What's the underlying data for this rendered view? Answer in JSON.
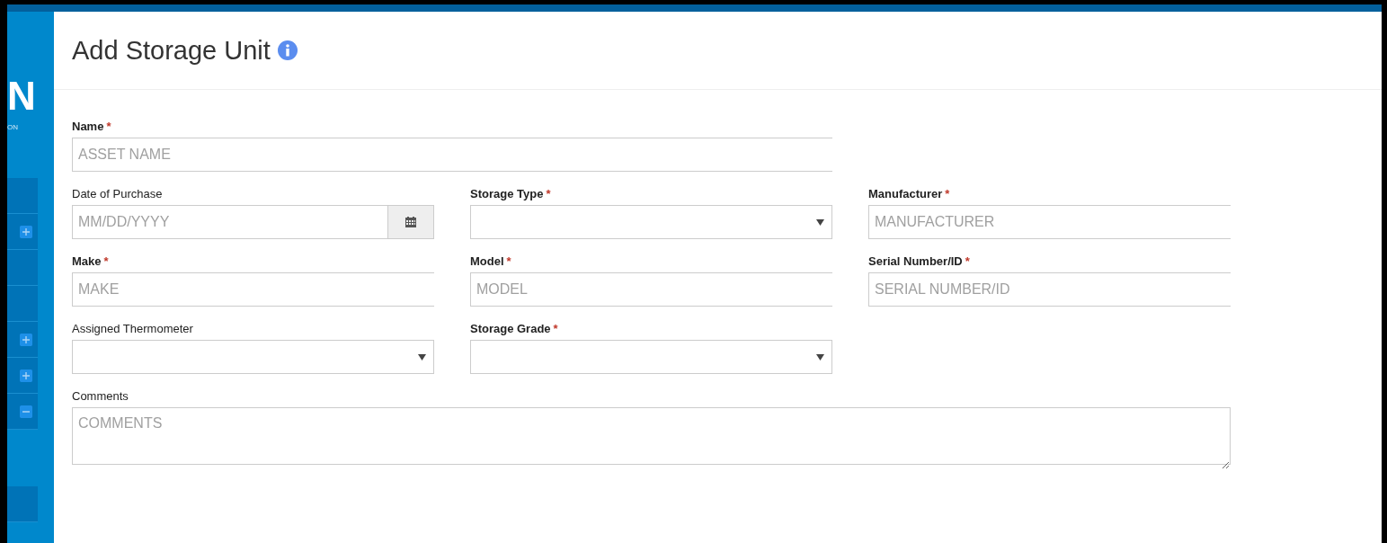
{
  "sidebar": {
    "logo_letter": "N",
    "logo_caption": "ON",
    "items": [
      {
        "kind": "plain"
      },
      {
        "kind": "plus"
      },
      {
        "kind": "plain"
      },
      {
        "kind": "plain"
      },
      {
        "kind": "plus"
      },
      {
        "kind": "plus"
      },
      {
        "kind": "minus"
      },
      {
        "kind": "gap"
      },
      {
        "kind": "plain"
      }
    ]
  },
  "page": {
    "title": "Add Storage Unit"
  },
  "form": {
    "rows": [
      [
        {
          "label": "Name",
          "required": true,
          "required_mark": "*",
          "kind": "text",
          "placeholder": "ASSET NAME"
        }
      ],
      [
        {
          "label": "Date of Purchase",
          "required": false,
          "kind": "date",
          "placeholder": "MM/DD/YYYY"
        },
        {
          "label": "Storage Type",
          "required": true,
          "required_mark": "*",
          "kind": "select"
        },
        {
          "label": "Manufacturer",
          "required": true,
          "required_mark": "*",
          "kind": "text",
          "placeholder": "MANUFACTURER"
        }
      ],
      [
        {
          "label": "Make",
          "required": true,
          "required_mark": "*",
          "kind": "text",
          "placeholder": "MAKE"
        },
        {
          "label": "Model",
          "required": true,
          "required_mark": "*",
          "kind": "text",
          "placeholder": "MODEL"
        },
        {
          "label": "Serial Number/ID",
          "required": true,
          "required_mark": "*",
          "kind": "text",
          "placeholder": "SERIAL NUMBER/ID"
        }
      ],
      [
        {
          "label": "Assigned Thermometer",
          "required": false,
          "kind": "select"
        },
        {
          "label": "Storage Grade",
          "required": true,
          "required_mark": "*",
          "kind": "select"
        }
      ],
      [
        {
          "label": "Comments",
          "required": false,
          "kind": "textarea",
          "placeholder": "COMMENTS"
        }
      ]
    ]
  }
}
